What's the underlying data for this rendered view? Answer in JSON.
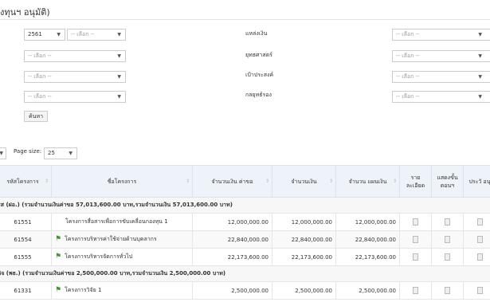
{
  "page": {
    "title": "งทุนฯ อนุมัติ)"
  },
  "filters": {
    "year_value": "2561",
    "placeholder": "-- เลือก --",
    "labels": {
      "funding_source": "แหล่งเงิน",
      "strategy": "ยุทธศาสตร์",
      "objective": "เป้าประสงค์",
      "tactic": "กลยุทธ์รอง"
    },
    "search_button": "ค้นหา"
  },
  "pagination": {
    "page_size_label": "Page size:",
    "page_size_value": "25"
  },
  "table": {
    "headers": {
      "code": "รหัสโครงการ",
      "name": "ชื่อโครงการ",
      "request_amount": "จำนวนเงิน ค่าขอ",
      "amount": "จำนวนเงิน",
      "plan_amount": "จำนวน แผนเงิน",
      "detail": "ราย ละเอียด",
      "show_answer": "แสดงขั้น ตอนฯ",
      "assess": "ประวั อนุ"
    },
    "group1": "รส (ฝอ.) (รวมจำนวนเงินค่าขอ 57,013,600.00 บาท,รวมจำนวนเงิน 57,013,600.00 บาท)",
    "group2": "กิจ (พธ.) (รวมจำนวนเงินค่าขอ 2,500,000.00 บาท,รวมจำนวนเงิน 2,500,000.00 บาท)",
    "rows1": [
      {
        "code": "61551",
        "name": "โครงการสื่อสารเพื่อการขับเคลื่อนกองทุน 1",
        "request": "12,000,000.00",
        "amount": "12,000,000.00",
        "plan": "12,000,000.00"
      },
      {
        "code": "61554",
        "name": "โครงการบริหารค่าใช้จ่ายด้านบุคลากร",
        "request": "22,840,000.00",
        "amount": "22,840,000.00",
        "plan": "22,840,000.00"
      },
      {
        "code": "61555",
        "name": "โครงการบริหารจัดการทั่วไป",
        "request": "22,173,600.00",
        "amount": "22,173,600.00",
        "plan": "22,173,600.00"
      }
    ],
    "rows2": [
      {
        "code": "61331",
        "name": "โครงการวิจัย 1",
        "request": "2,500,000.00",
        "amount": "2,500,000.00",
        "plan": "2,500,000.00"
      }
    ]
  }
}
